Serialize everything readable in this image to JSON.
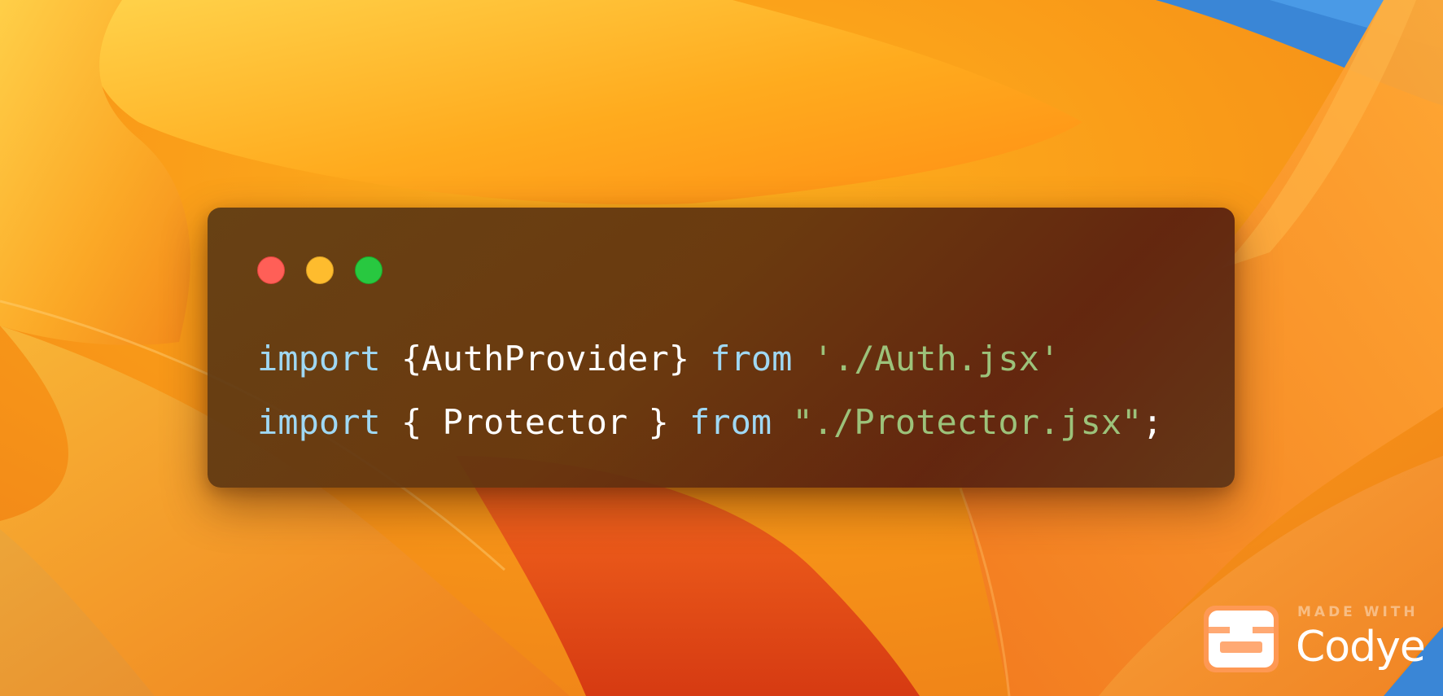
{
  "code_lines": [
    {
      "tokens": [
        {
          "type": "keyword",
          "text": "import"
        },
        {
          "type": "plain",
          "text": " {AuthProvider} "
        },
        {
          "type": "keyword",
          "text": "from"
        },
        {
          "type": "plain",
          "text": " "
        },
        {
          "type": "string",
          "text": "'./Auth.jsx'"
        }
      ]
    },
    {
      "tokens": [
        {
          "type": "keyword",
          "text": "import"
        },
        {
          "type": "plain",
          "text": " { Protector } "
        },
        {
          "type": "keyword",
          "text": "from"
        },
        {
          "type": "plain",
          "text": " "
        },
        {
          "type": "string",
          "text": "\"./Protector.jsx\""
        },
        {
          "type": "plain",
          "text": ";"
        }
      ]
    }
  ],
  "window_controls": [
    {
      "name": "close-button",
      "color": "#ff5f57"
    },
    {
      "name": "minimize-button",
      "color": "#febc2e"
    },
    {
      "name": "zoom-button",
      "color": "#28c840"
    }
  ],
  "branding": {
    "made_with": "MADE WITH",
    "name": "Codye",
    "icon": "codye-logo-icon"
  },
  "colors": {
    "keyword": "#9fd8f4",
    "string": "#9cc27a",
    "plain": "#ffffff",
    "window_bg": "#5c3a14"
  }
}
